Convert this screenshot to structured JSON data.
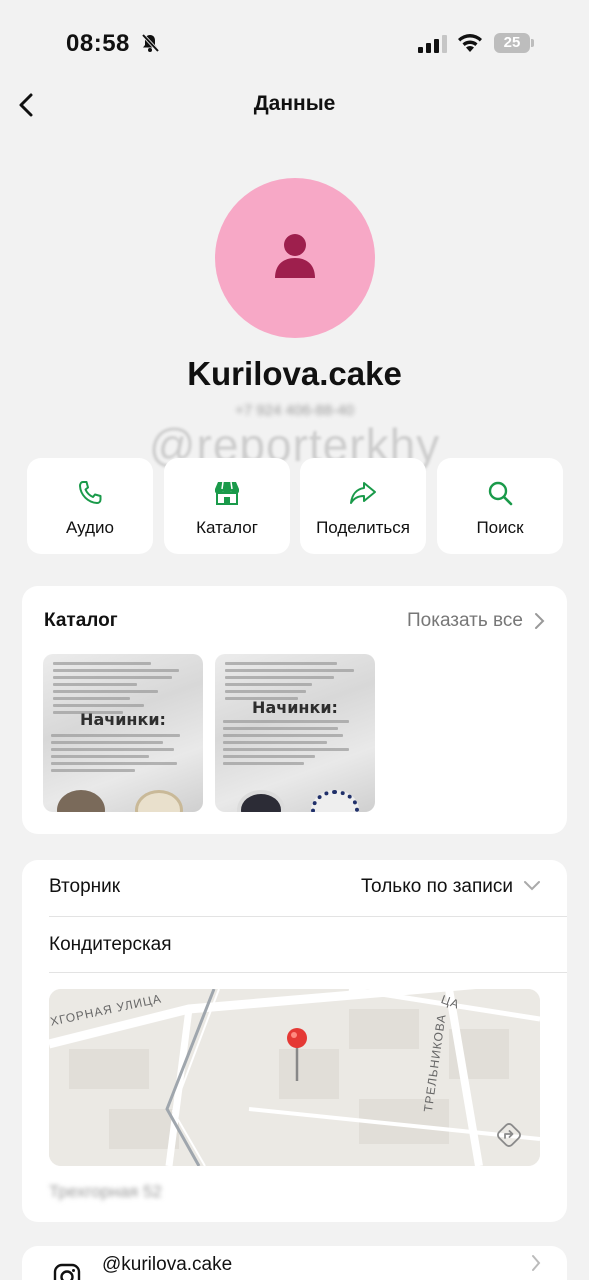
{
  "status": {
    "time": "08:58",
    "battery": "25"
  },
  "header": {
    "title": "Данные"
  },
  "profile": {
    "name": "Kurilova.cake",
    "phone": "+7 924 406-88-40",
    "watermark": "@reporterkhy"
  },
  "actions": [
    {
      "label": "Аудио",
      "icon": "phone-icon"
    },
    {
      "label": "Каталог",
      "icon": "store-icon"
    },
    {
      "label": "Поделиться",
      "icon": "share-icon"
    },
    {
      "label": "Поиск",
      "icon": "search-icon"
    }
  ],
  "catalog": {
    "title": "Каталог",
    "show_all": "Показать все",
    "items": [
      {
        "heading": "Начинки:"
      },
      {
        "heading": "Начинки:"
      }
    ]
  },
  "info": {
    "day": "Вторник",
    "hours": "Только по записи",
    "category": "Кондитерская",
    "map_labels": {
      "street1": "ХГОРНАЯ УЛИЦА",
      "street2": "ТРЕЛЬНИКОВА",
      "street3": "ЦА"
    },
    "address": "Трехгорная 52"
  },
  "instagram": {
    "handle": "@kurilova.cake"
  },
  "colors": {
    "accent": "#1a9a4a",
    "avatar_bg": "#f7a8c6",
    "avatar_fg": "#9e1f4d",
    "pin": "#e53935"
  }
}
